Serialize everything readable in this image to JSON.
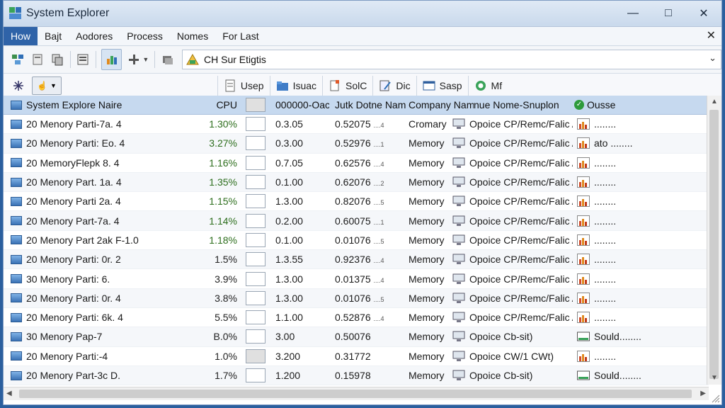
{
  "window": {
    "title": "System Explorer"
  },
  "menu": [
    "How",
    "Bajt",
    "Aodores",
    "Process",
    "Nomes",
    "For Last"
  ],
  "path": {
    "text": "CH Sur Etigtis"
  },
  "toolbar2": {
    "btn1": "Usep",
    "btn2": "Isuac",
    "btn3": "SolC",
    "btn4": "Dic",
    "btn5": "Sasp",
    "btn6": "Mf"
  },
  "header": {
    "name": "System Explore Naire",
    "cpu": "CPU",
    "mem": "000000-Oac",
    "faults": "Jutk Dotne Nam.",
    "comp": "Company Name",
    "desc": "nue Nome-Snuplon",
    "stat": "Ousse"
  },
  "rows": [
    {
      "name": "20 Menory Parti-7a. 4",
      "cpu": "1.30%",
      "mem": "0.3.05",
      "faults": "0.52075",
      "fsuf": "....4",
      "comp": "Cromary",
      "desc": "Opoice CP/Remc/Falic A",
      "stat": "........"
    },
    {
      "name": "20 Menory Parti: Eo. 4",
      "cpu": "3.27%",
      "mem": "0.3.00",
      "faults": "0.52976",
      "fsuf": "....1",
      "comp": "Memory",
      "desc": "Opoice CP/Remc/Falic A",
      "stat": "ato ........"
    },
    {
      "name": "20 MemoryFlepk 8. 4",
      "cpu": "1.16%",
      "mem": "0.7.05",
      "faults": "0.62576",
      "fsuf": "....4",
      "comp": "Memory",
      "desc": "Opoice CP/Remc/Falic A",
      "stat": "........"
    },
    {
      "name": "20 Menory Part. 1a. 4",
      "cpu": "1.35%",
      "mem": "0.1.00",
      "faults": "0.62076",
      "fsuf": "....2",
      "comp": "Memory",
      "desc": "Opoice CP/Remc/Falic A",
      "stat": "........"
    },
    {
      "name": "20 Menory Parti 2a. 4",
      "cpu": "1.15%",
      "mem": "1.3.00",
      "faults": "0.82076",
      "fsuf": "....5",
      "comp": "Memory",
      "desc": "Opoice CP/Remc/Falic A",
      "stat": "........"
    },
    {
      "name": "20 Menory Part-7a. 4",
      "cpu": "1.14%",
      "mem": "0.2.00",
      "faults": "0.60075",
      "fsuf": "....1",
      "comp": "Memory",
      "desc": "Opoice CP/Remc/Falic A",
      "stat": "........"
    },
    {
      "name": "20 Menory Part 2ak F-1.0",
      "cpu": "1.18%",
      "mem": "0.1.00",
      "faults": "0.01076",
      "fsuf": "....5",
      "comp": "Memory",
      "desc": "Opoice CP/Remc/Falic A",
      "stat": "........"
    },
    {
      "name": "20 Menory Parti: 0r. 2",
      "cpu": "1.5%",
      "mem": "1.3.55",
      "faults": "0.92376",
      "fsuf": "....4",
      "comp": "Memory",
      "desc": "Opoice CP/Remc/Falic A",
      "stat": "........"
    },
    {
      "name": "30 Menory Parti: 6.",
      "cpu": "3.9%",
      "mem": "1.3.00",
      "faults": "0.01375",
      "fsuf": "....4",
      "comp": "Memory",
      "desc": "Opoice CP/Remc/Falic A",
      "stat": "........"
    },
    {
      "name": "20 Menory Parti: 0r. 4",
      "cpu": "3.8%",
      "mem": "1.3.00",
      "faults": "0.01076",
      "fsuf": "....5",
      "comp": "Memory",
      "desc": "Opoice CP/Remc/Falic A",
      "stat": "........"
    },
    {
      "name": "20 Menory Parti: 6k. 4",
      "cpu": "5.5%",
      "mem": "1.1.00",
      "faults": "0.52876",
      "fsuf": "....4",
      "comp": "Memory",
      "desc": "Opoice CP/Remc/Falic A",
      "stat": "........"
    },
    {
      "name": "30 Menory Pap-7",
      "cpu": "B.0%",
      "mem": "3.00",
      "faults": "0.50076",
      "fsuf": "",
      "comp": "Memory",
      "desc": "Opoice Cb-sit)",
      "stat": "Sould........"
    },
    {
      "name": "20 Menory Parti:-4",
      "cpu": "1.0%",
      "mem": "3.200",
      "faults": "0.31772",
      "fsuf": "",
      "comp": "Memory",
      "desc": "Opoice CW/1 CWt)",
      "stat": "........"
    },
    {
      "name": "20 Menory Part-3c D.",
      "cpu": "1.7%",
      "mem": "1.200",
      "faults": "0.15978",
      "fsuf": "",
      "comp": "Memory",
      "desc": "Opoice Cb-sit)",
      "stat": "Sould........"
    }
  ]
}
